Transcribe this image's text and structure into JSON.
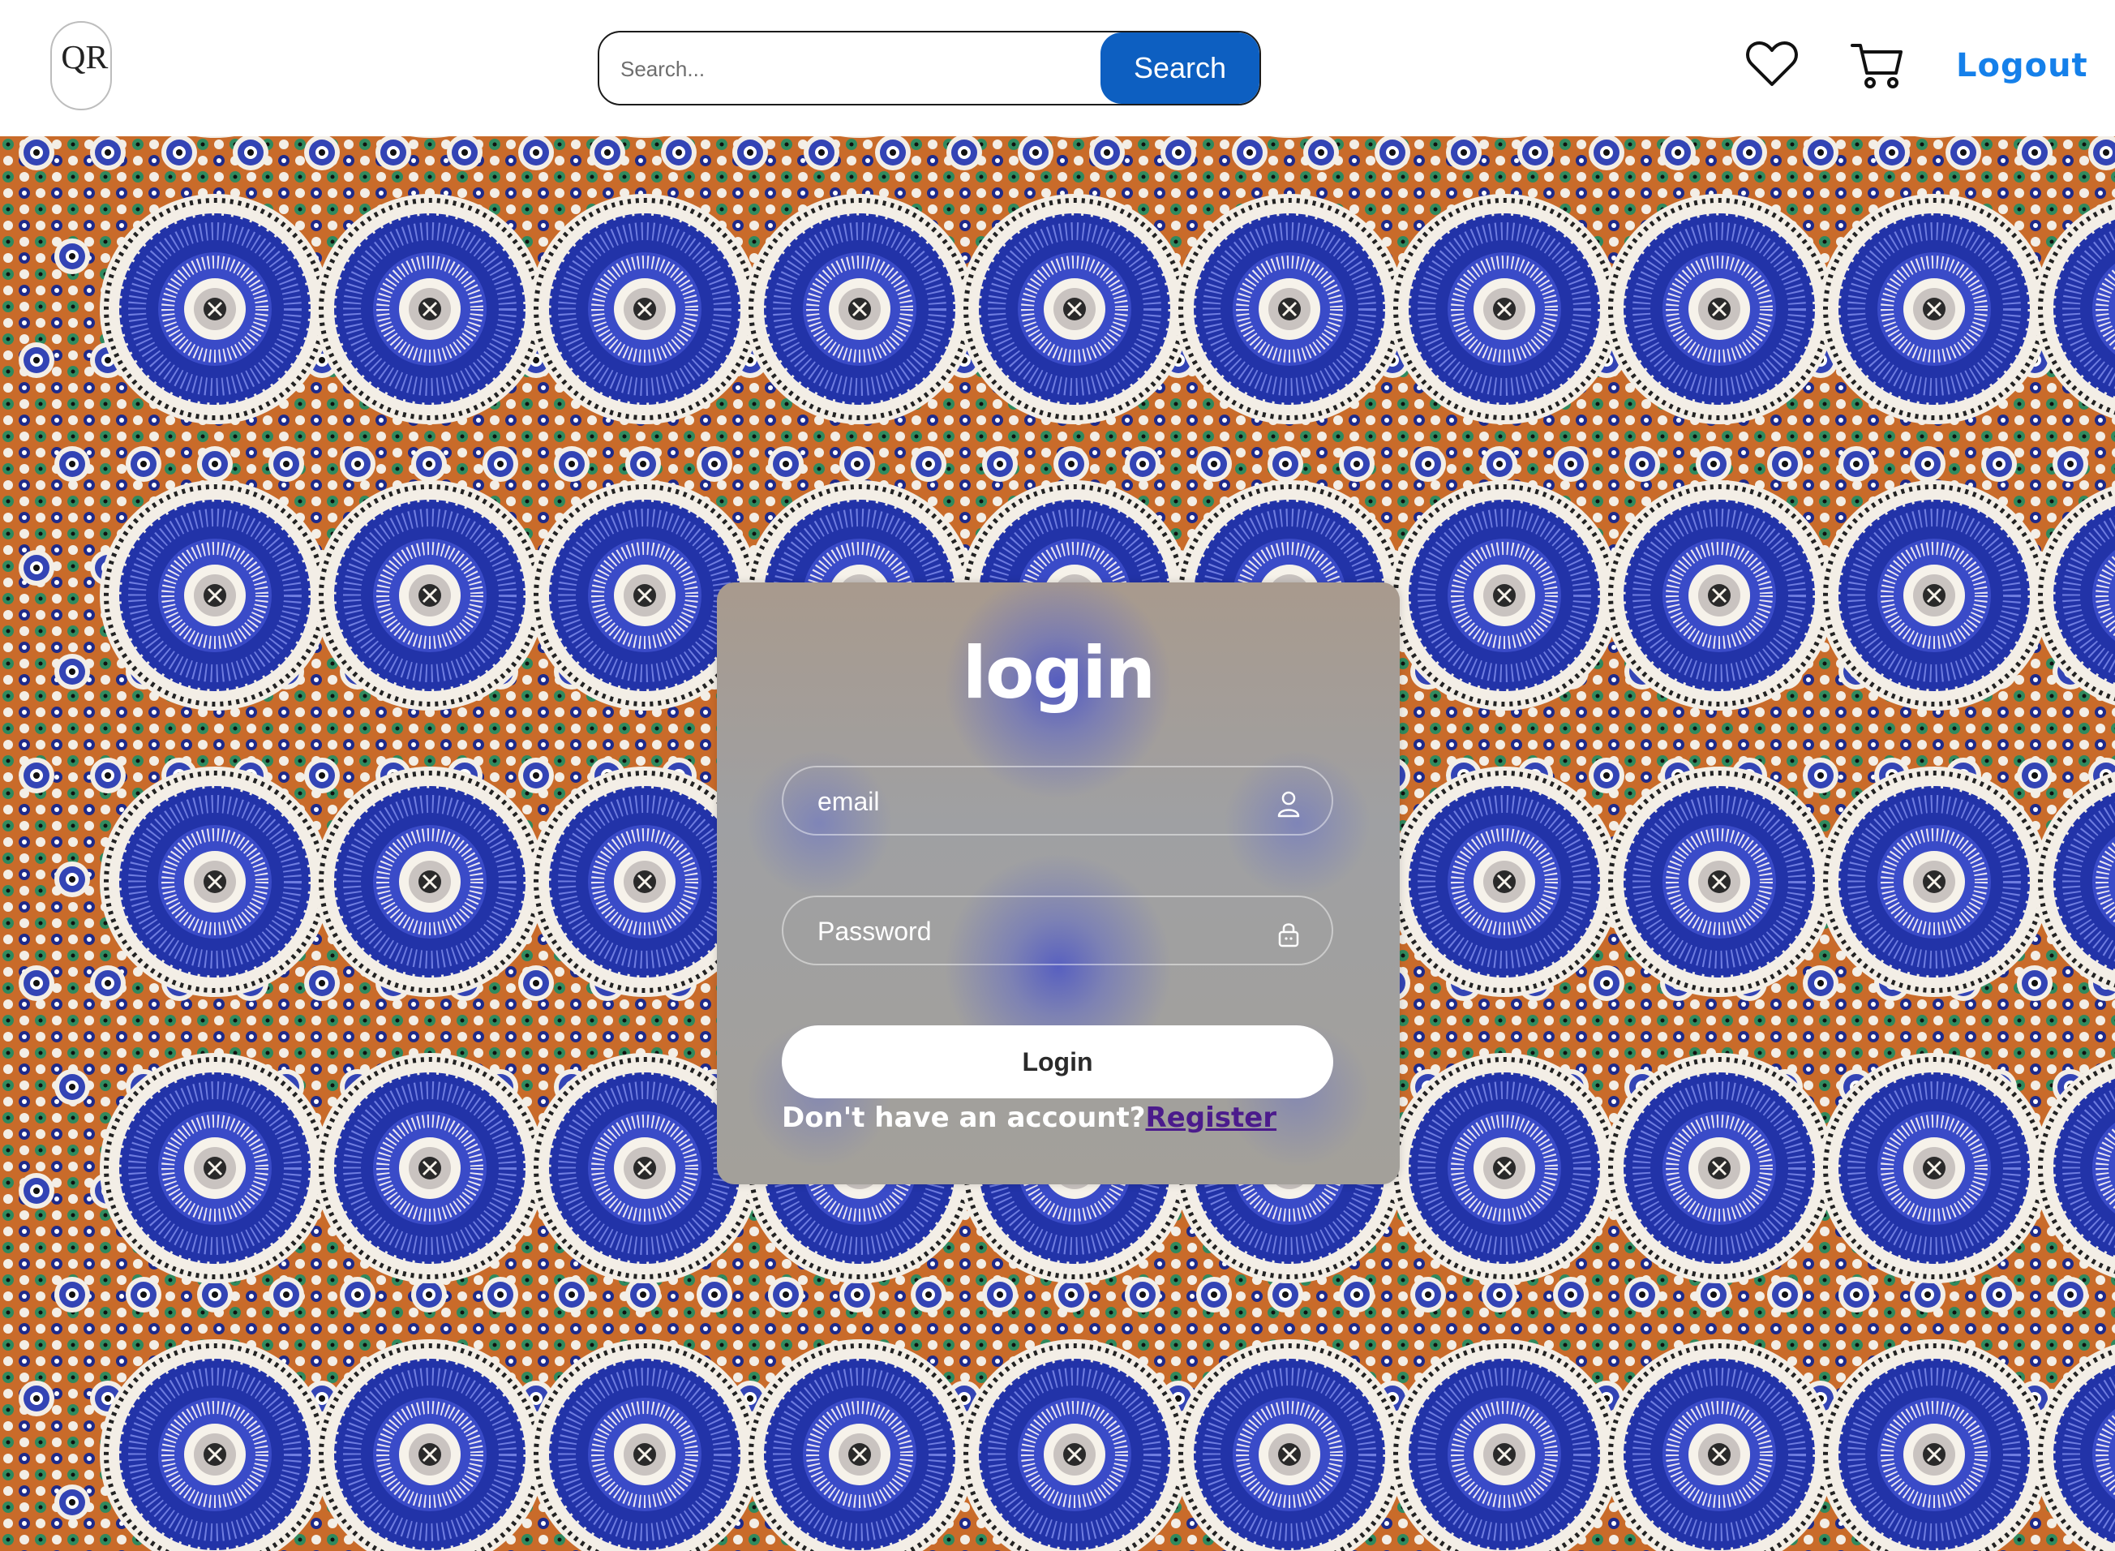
{
  "header": {
    "logo_text": "QR",
    "search": {
      "placeholder": "Search...",
      "button_label": "Search"
    },
    "wishlist_icon": "heart-icon",
    "cart_icon": "cart-icon",
    "logout_label": "Logout"
  },
  "login_card": {
    "title": "login",
    "email_placeholder": "email",
    "email_icon": "user-icon",
    "password_placeholder": "Password",
    "password_icon": "lock-icon",
    "submit_label": "Login",
    "register_prompt": "Don't have an account?",
    "register_link": "Register"
  },
  "colors": {
    "search_button": "#0d5fc1",
    "logout_link": "#1580ea",
    "register_link": "#4b1b8c",
    "tile_blue": "#2f3fb8",
    "tile_orange": "#c96b2a",
    "tile_green": "#2f8a5e"
  }
}
